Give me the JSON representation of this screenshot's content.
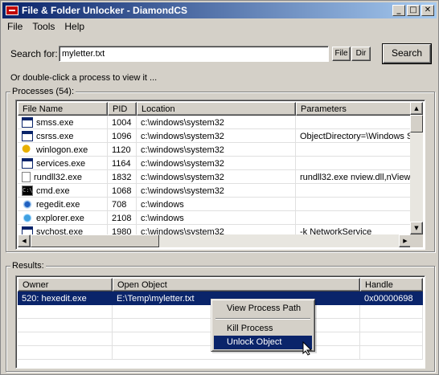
{
  "window": {
    "title": "File & Folder Unlocker - DiamondCS",
    "minimize": "_",
    "maximize": "□",
    "close": "✕"
  },
  "menu": [
    "File",
    "Tools",
    "Help"
  ],
  "search": {
    "label": "Search for:",
    "value": "myletter.txt",
    "file_button": "File",
    "dir_button": "Dir",
    "search_button": "Search"
  },
  "hint": "Or double-click a process to view it ...",
  "processes": {
    "group_label": "Processes (54):",
    "columns": [
      "File Name",
      "PID",
      "Location",
      "Parameters"
    ],
    "rows": [
      {
        "icon": "window-icon",
        "name": "smss.exe",
        "pid": "1004",
        "location": "c:\\windows\\system32",
        "params": ""
      },
      {
        "icon": "window-icon",
        "name": "csrss.exe",
        "pid": "1096",
        "location": "c:\\windows\\system32",
        "params": "ObjectDirectory=\\Windows S"
      },
      {
        "icon": "winlogon-icon",
        "name": "winlogon.exe",
        "pid": "1120",
        "location": "c:\\windows\\system32",
        "params": ""
      },
      {
        "icon": "window-icon",
        "name": "services.exe",
        "pid": "1164",
        "location": "c:\\windows\\system32",
        "params": ""
      },
      {
        "icon": "document-icon",
        "name": "rundll32.exe",
        "pid": "1832",
        "location": "c:\\windows\\system32",
        "params": "rundll32.exe nview.dll,nViewIn"
      },
      {
        "icon": "cmd-icon",
        "name": "cmd.exe",
        "pid": "1068",
        "location": "c:\\windows\\system32",
        "params": ""
      },
      {
        "icon": "regedit-icon",
        "name": "regedit.exe",
        "pid": "708",
        "location": "c:\\windows",
        "params": ""
      },
      {
        "icon": "explorer-icon",
        "name": "explorer.exe",
        "pid": "2108",
        "location": "c:\\windows",
        "params": ""
      },
      {
        "icon": "window-icon",
        "name": "svchost.exe",
        "pid": "1980",
        "location": "c:\\windows\\system32",
        "params": "-k NetworkService"
      }
    ]
  },
  "results": {
    "group_label": "Results:",
    "columns": [
      "Owner",
      "Open Object",
      "Handle"
    ],
    "rows": [
      {
        "owner": "520: hexedit.exe",
        "object": "E:\\Temp\\myletter.txt",
        "handle": "0x00000698"
      }
    ]
  },
  "context_menu": {
    "items": [
      "View Process Path",
      "Kill Process",
      "Unlock Object"
    ],
    "active": "Unlock Object"
  }
}
